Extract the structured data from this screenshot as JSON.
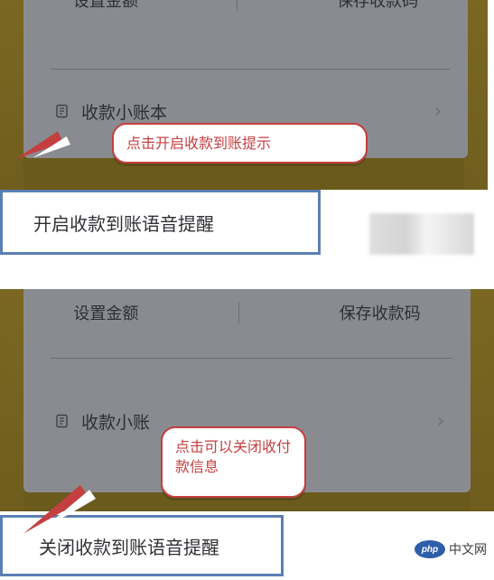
{
  "top": {
    "actions": [
      "设置金额",
      "保存收款码"
    ],
    "ledger_label": "收款小账本",
    "callout_text": "点击开启收款到账提示",
    "sheet_option_label": "开启收款到账语音提醒"
  },
  "bottom": {
    "actions": [
      "设置金额",
      "保存收款码"
    ],
    "ledger_label": "收款小账",
    "callout_text": "点击可以关闭收付款信息",
    "sheet_option_label": "关闭收款到账语音提醒",
    "watermark_logo": "php",
    "watermark_text": "中文网"
  },
  "colors": {
    "dim_card": "#8a8b90",
    "dim_yellow": "#6b5a1d",
    "highlight_border": "#5b7fb5",
    "callout_red": "#c43f3f",
    "text_dark": "#2f3135",
    "watermark_blue": "#2d5ea9"
  },
  "icons": {
    "ledger": "ledger-book-icon",
    "chevron": "chevron-right-icon"
  }
}
